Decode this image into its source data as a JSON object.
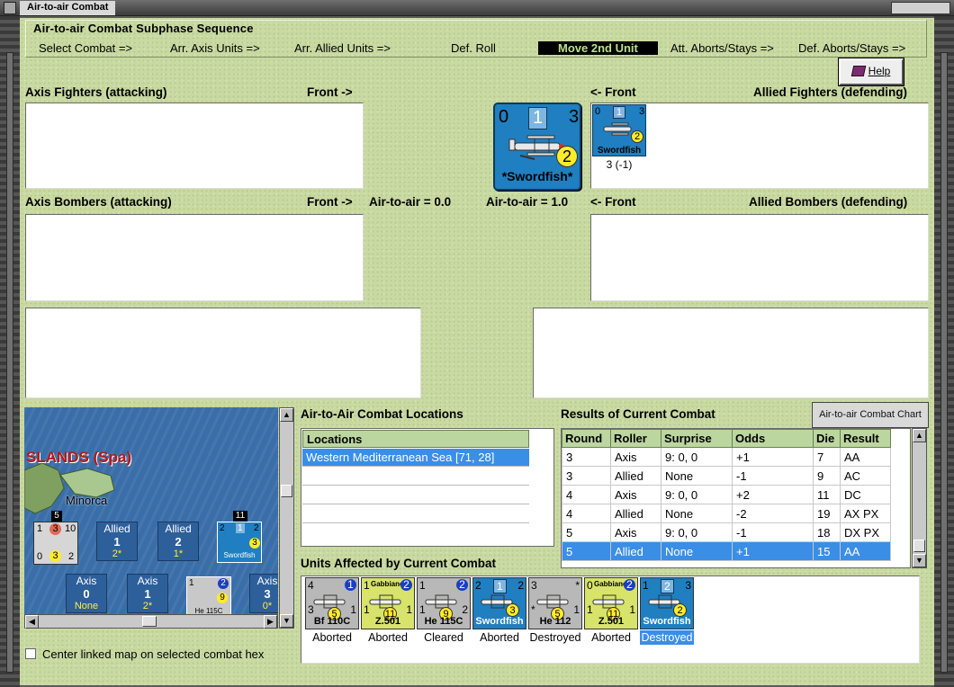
{
  "window": {
    "title": "Air-to-air Combat"
  },
  "subphase": {
    "title": "Air-to-air Combat Subphase Sequence",
    "steps": [
      "Select Combat =>",
      "Arr. Axis Units =>",
      "Arr. Allied Units =>",
      "Def. Roll",
      "Move 2nd Unit",
      "Att. Aborts/Stays =>",
      "Def. Aborts/Stays =>"
    ],
    "active_step": "Move 2nd Unit"
  },
  "help_button": {
    "label": "Help",
    "icon": "help-book-icon"
  },
  "panels": {
    "axis_fighters": "Axis Fighters (attacking)",
    "allied_fighters": "Allied Fighters (defending)",
    "axis_bombers": "Axis Bombers (attacking)",
    "allied_bombers": "Allied Bombers (defending)",
    "front_right": "Front ->",
    "front_left": "<- Front",
    "axis_air_to_air": "Air-to-air = 0.0",
    "allied_air_to_air": "Air-to-air = 1.0"
  },
  "selected_unit": {
    "left": "0",
    "middle": "1",
    "right": "3",
    "circle": "2",
    "name": "*Swordfish*",
    "icon": "biplane-icon"
  },
  "allied_fighter_unit": {
    "left": "0",
    "middle": "1",
    "right": "3",
    "circle": "2",
    "name": "Swordfish",
    "caption": "3 (-1)"
  },
  "map": {
    "region_label": "SLANDS (Spa)",
    "island_label": "Minorca",
    "stack_left": {
      "top": "5",
      "a": "1",
      "b": "3",
      "c": "10",
      "d": "0",
      "e": "3",
      "f": "2"
    },
    "stack_right": {
      "top": "11",
      "a": "2",
      "b": "1",
      "c": "2",
      "d": "3",
      "name": "Swordfish"
    },
    "he115": {
      "a": "1",
      "b": "2",
      "c": "9",
      "name": "He 115C"
    },
    "boxes": [
      {
        "title": "Allied",
        "value": "1",
        "sub": "2*"
      },
      {
        "title": "Allied",
        "value": "2",
        "sub": "1*"
      },
      {
        "title": "Axis",
        "value": "0",
        "sub": "None"
      },
      {
        "title": "Axis",
        "value": "1",
        "sub": "2*"
      },
      {
        "title": "Axis",
        "value": "3",
        "sub": "0*"
      }
    ]
  },
  "center_map": {
    "label": "Center linked map on selected combat hex",
    "checked": false
  },
  "locations": {
    "title": "Air-to-Air Combat Locations",
    "column": "Locations",
    "rows": [
      "Western Mediterranean Sea [71, 28]"
    ]
  },
  "results": {
    "title": "Results of Current Combat",
    "chart_button": "Air-to-air Combat Chart",
    "columns": [
      "Round",
      "Roller",
      "Surprise",
      "Odds",
      "Die",
      "Result"
    ],
    "rows": [
      [
        "3",
        "Axis",
        "9: 0, 0",
        "+1",
        "7",
        "AA"
      ],
      [
        "3",
        "Allied",
        "None",
        "-1",
        "9",
        "AC"
      ],
      [
        "4",
        "Axis",
        "9: 0, 0",
        "+2",
        "11",
        "DC"
      ],
      [
        "4",
        "Allied",
        "None",
        "-2",
        "19",
        "AX PX"
      ],
      [
        "5",
        "Axis",
        "9: 0, 0",
        "-1",
        "18",
        "DX PX"
      ],
      [
        "5",
        "Allied",
        "None",
        "+1",
        "15",
        "AA"
      ]
    ],
    "selected_row": 5
  },
  "units_affected": {
    "title": "Units Affected by Current Combat",
    "units": [
      {
        "name": "Bf 110C",
        "tl": "4",
        "tr": "1",
        "bl": "3",
        "br": "1",
        "circle": "5",
        "status": "Aborted",
        "color": "#b8b8b8",
        "cc": "#ffeb2a"
      },
      {
        "name": "Z.501",
        "tl": "1",
        "tr": "2",
        "bl": "1",
        "br": "1",
        "circle": "11",
        "status": "Aborted",
        "color": "#d7e36a",
        "cc": "#ffeb2a",
        "top": "Gabbiano"
      },
      {
        "name": "He 115C",
        "tl": "1",
        "tr": "2",
        "bl": "1",
        "br": "2",
        "circle": "9",
        "status": "Cleared",
        "color": "#b8b8b8",
        "cc": "#ffeb2a"
      },
      {
        "name": "Swordfish",
        "tl": "2",
        "tr": "2",
        "bl": "",
        "br": "",
        "circle": "3",
        "status": "Aborted",
        "color": "#1f7fc0",
        "cc": "#ffeb2a",
        "mid": "1"
      },
      {
        "name": "He 112",
        "tl": "3",
        "tr": "*",
        "bl": "*",
        "br": "1",
        "circle": "5",
        "status": "Destroyed",
        "color": "#b8b8b8",
        "cc": "#ffeb2a"
      },
      {
        "name": "Z.501",
        "tl": "0",
        "tr": "2",
        "bl": "1",
        "br": "1",
        "circle": "11",
        "status": "Aborted",
        "color": "#d7e36a",
        "cc": "#ffeb2a",
        "top": "Gabbiano"
      },
      {
        "name": "Swordfish",
        "tl": "1",
        "tr": "3",
        "bl": "",
        "br": "",
        "circle": "2",
        "status": "Destroyed",
        "color": "#1f7fc0",
        "cc": "#ffeb2a",
        "mid": "2",
        "selected": true
      }
    ]
  }
}
